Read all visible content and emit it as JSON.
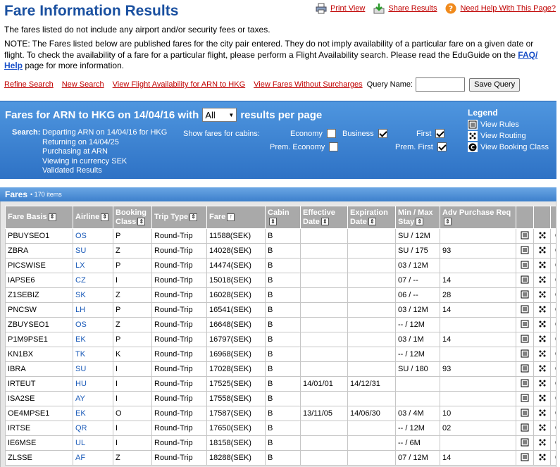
{
  "header": {
    "title": "Fare Information Results",
    "print_label": "Print View",
    "share_label": "Share Results",
    "help_label": "Need Help With This Page?"
  },
  "notes": {
    "line1": "The fares listed do not include any airport and/or security fees or taxes.",
    "line2": "NOTE: The Fares listed below are published fares for the city pair entered. They do not imply availability of a particular fare on a given date or flight. To check the availability of a fare for a particular flight, please perform a Flight Availability search. Please read the EduGuide on the ",
    "link": "FAQ/ Help",
    "line2_end": " page for more information."
  },
  "actions": {
    "refine": "Refine Search",
    "new": "New Search",
    "availability": "View Flight Availability for ARN to HKG",
    "without_surcharges": "View Fares Without Surcharges",
    "query_label": "Query Name:",
    "query_value": "",
    "save": "Save Query"
  },
  "panel": {
    "title_prefix": "Fares for ARN to HKG on 14/04/16 with",
    "per_page_value": "All",
    "title_suffix": "results per page",
    "search_label": "Search:",
    "search_lines": [
      "Departing ARN on 14/04/16 for HKG",
      "Returning on 14/04/25",
      "Purchasing at ARN",
      "Viewing in currency SEK",
      "Validated Results"
    ],
    "cabins_label": "Show fares for cabins:",
    "cabins": [
      {
        "label": "Economy",
        "checked": false
      },
      {
        "label": "Business",
        "checked": true
      },
      {
        "label": "First",
        "checked": true
      },
      {
        "label": "Prem. Economy",
        "checked": false
      },
      {
        "label": "Prem. First",
        "checked": true
      }
    ],
    "legend_title": "Legend",
    "legend_rules": "View Rules",
    "legend_routing": "View Routing",
    "legend_booking": "View Booking Class"
  },
  "fares": {
    "label": "Fares",
    "count": "• 170 items",
    "columns": [
      "Fare Basis",
      "Airline",
      "Booking Class",
      "Trip Type",
      "Fare",
      "Cabin",
      "Effective Date",
      "Expiration Date",
      "Min / Max Stay",
      "Adv Purchase Req"
    ],
    "rows": [
      [
        "PBUYSEO1",
        "OS",
        "P",
        "Round-Trip",
        "11588(SEK)",
        "B",
        "",
        "",
        "SU / 12M",
        ""
      ],
      [
        "ZBRA",
        "SU",
        "Z",
        "Round-Trip",
        "14028(SEK)",
        "B",
        "",
        "",
        "SU / 175",
        "93"
      ],
      [
        "PICSWISE",
        "LX",
        "P",
        "Round-Trip",
        "14474(SEK)",
        "B",
        "",
        "",
        "03 / 12M",
        ""
      ],
      [
        "IAPSE6",
        "CZ",
        "I",
        "Round-Trip",
        "15018(SEK)",
        "B",
        "",
        "",
        "07 / --",
        "14"
      ],
      [
        "Z1SEBIZ",
        "SK",
        "Z",
        "Round-Trip",
        "16028(SEK)",
        "B",
        "",
        "",
        "06 / --",
        "28"
      ],
      [
        "PNCSW",
        "LH",
        "P",
        "Round-Trip",
        "16541(SEK)",
        "B",
        "",
        "",
        "03 / 12M",
        "14"
      ],
      [
        "ZBUYSEO1",
        "OS",
        "Z",
        "Round-Trip",
        "16648(SEK)",
        "B",
        "",
        "",
        "-- / 12M",
        ""
      ],
      [
        "P1M9PSE1",
        "EK",
        "P",
        "Round-Trip",
        "16797(SEK)",
        "B",
        "",
        "",
        "03 / 1M",
        "14"
      ],
      [
        "KN1BX",
        "TK",
        "K",
        "Round-Trip",
        "16968(SEK)",
        "B",
        "",
        "",
        "-- / 12M",
        ""
      ],
      [
        "IBRA",
        "SU",
        "I",
        "Round-Trip",
        "17028(SEK)",
        "B",
        "",
        "",
        "SU / 180",
        "93"
      ],
      [
        "IRTEUT",
        "HU",
        "I",
        "Round-Trip",
        "17525(SEK)",
        "B",
        "14/01/01",
        "14/12/31",
        "",
        ""
      ],
      [
        "ISA2SE",
        "AY",
        "I",
        "Round-Trip",
        "17558(SEK)",
        "B",
        "",
        "",
        "",
        ""
      ],
      [
        "OE4MPSE1",
        "EK",
        "O",
        "Round-Trip",
        "17587(SEK)",
        "B",
        "13/11/05",
        "14/06/30",
        "03 / 4M",
        "10"
      ],
      [
        "IRTSE",
        "QR",
        "I",
        "Round-Trip",
        "17650(SEK)",
        "B",
        "",
        "",
        "-- / 12M",
        "02"
      ],
      [
        "IE6MSE",
        "UL",
        "I",
        "Round-Trip",
        "18158(SEK)",
        "B",
        "",
        "",
        "-- / 6M",
        ""
      ],
      [
        "ZLSSE",
        "AF",
        "Z",
        "Round-Trip",
        "18288(SEK)",
        "B",
        "",
        "",
        "07 / 12M",
        "14"
      ]
    ]
  }
}
